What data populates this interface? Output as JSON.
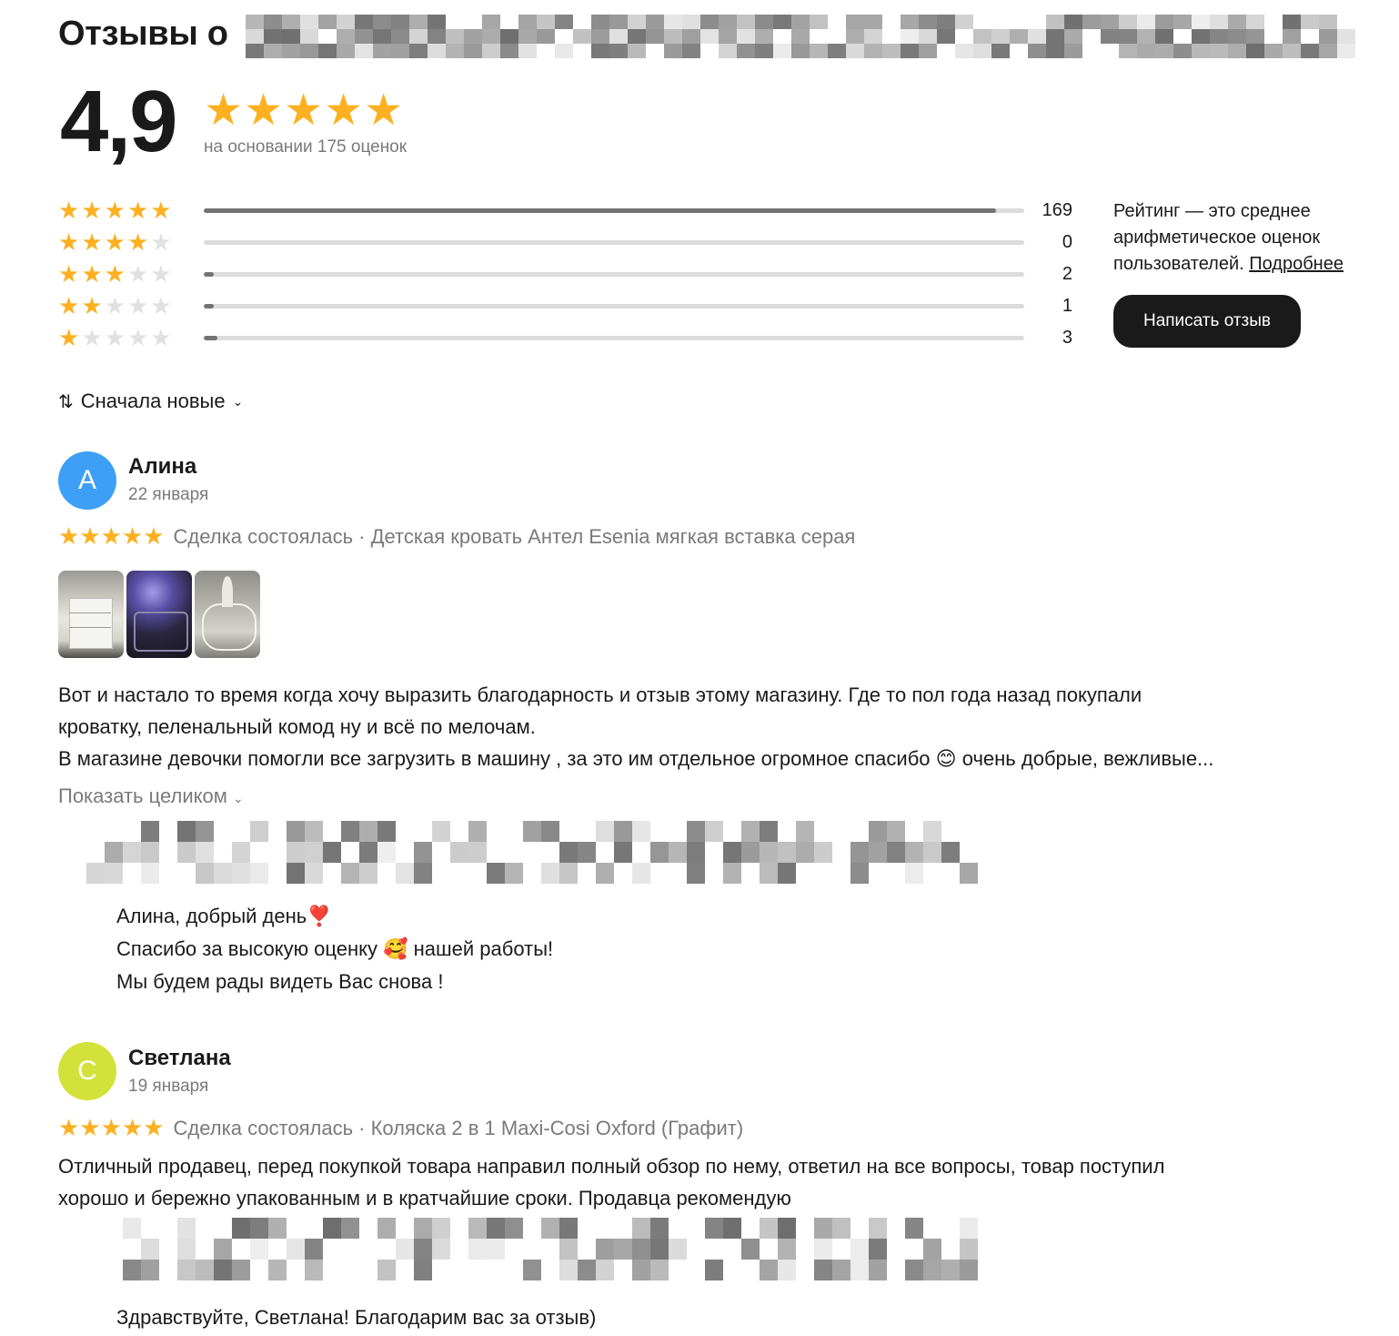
{
  "header": {
    "title_prefix": "Отзывы о"
  },
  "rating": {
    "value": "4,9",
    "stars": "★★★★★",
    "based_on": "на основании 175 оценок"
  },
  "histogram": [
    {
      "stars": 5,
      "count": "169",
      "fraction": 0.966
    },
    {
      "stars": 4,
      "count": "0",
      "fraction": 0.0
    },
    {
      "stars": 3,
      "count": "2",
      "fraction": 0.011
    },
    {
      "stars": 2,
      "count": "1",
      "fraction": 0.006
    },
    {
      "stars": 1,
      "count": "3",
      "fraction": 0.017
    }
  ],
  "info": {
    "text": "Рейтинг — это среднее арифметическое оценок пользователей.",
    "link": "Подробнее"
  },
  "write_button": "Написать отзыв",
  "sort": {
    "icon": "sort-arrows-icon",
    "label": "Сначала новые"
  },
  "reviews": [
    {
      "avatar_letter": "А",
      "avatar_color": "#3d9ff5",
      "author": "Алина",
      "date": "22 января",
      "stars": "★★★★★",
      "meta": "Сделка состоялась · Детская кровать Антел Esenia мягкая вставка серая",
      "text_lines": [
        "Вот и настало то время когда хочу выразить благодарность и отзыв этому магазину. Где то пол года назад покупали",
        "кроватку, пеленальный комод ну и всё по мелочам.",
        "В магазине девочки помогли все загрузить в машину , за это им отдельное огромное спасибо 😊 очень добрые, вежливые..."
      ],
      "show_more": "Показать целиком",
      "reply_lines": [
        "Алина, добрый день❣️",
        "Спасибо за высокую оценку 🥰 нашей работы!",
        "Мы будем рады видеть Вас снова !"
      ]
    },
    {
      "avatar_letter": "С",
      "avatar_color": "#d2e23a",
      "author": "Светлана",
      "date": "19 января",
      "stars": "★★★★★",
      "meta": "Сделка состоялась · Коляска 2 в 1 Maxi-Cosi Oxford (Графит)",
      "text_lines": [
        "Отличный продавец, перед покупкой товара направил полный обзор по нему, ответил на все вопросы, товар поступил",
        "хорошо и бережно упакованным и в кратчайшие сроки. Продавца рекомендую"
      ],
      "reply_lines": [
        "Здравствуйте, Светлана! Благодарим вас за отзыв)"
      ]
    }
  ],
  "colors": {
    "star": "#fdb021",
    "bar_fill": "#737373",
    "bar_track": "#dcdcdc",
    "button_bg": "#1a1a1a"
  }
}
